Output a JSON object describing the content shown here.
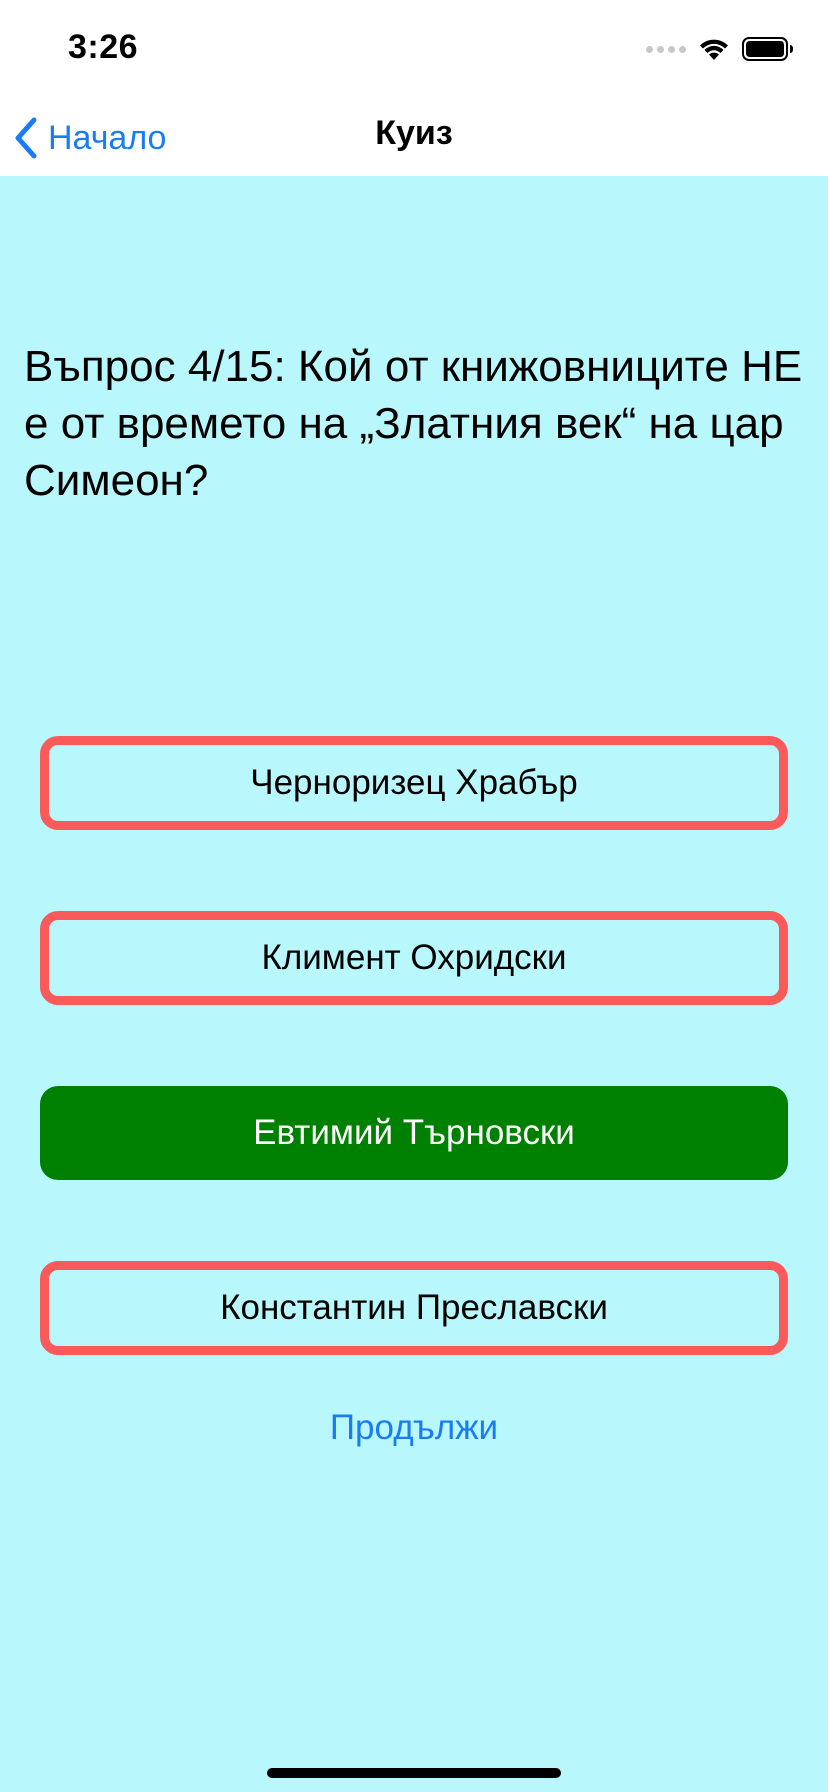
{
  "status_bar": {
    "time": "3:26"
  },
  "nav": {
    "back_label": "Начало",
    "title": "Куиз"
  },
  "question": {
    "text": "Въпрос 4/15: Кой от книжовниците НЕ е от времето на „Златния век“ на цар Симеон?"
  },
  "answers": [
    {
      "label": "Черноризец Храбър",
      "state": "wrong"
    },
    {
      "label": "Климент Охридски",
      "state": "wrong"
    },
    {
      "label": "Евтимий Търновски",
      "state": "correct"
    },
    {
      "label": "Константин Преславски",
      "state": "wrong"
    }
  ],
  "continue_label": "Продължи",
  "colors": {
    "background": "#b8f8fc",
    "accent": "#1a7cf5",
    "wrong_border": "#fa5a5a",
    "correct_fill": "#008000"
  },
  "icons": {
    "back": "chevron-left-icon",
    "signal": "cellular-signal-icon",
    "wifi": "wifi-icon",
    "battery": "battery-icon"
  }
}
